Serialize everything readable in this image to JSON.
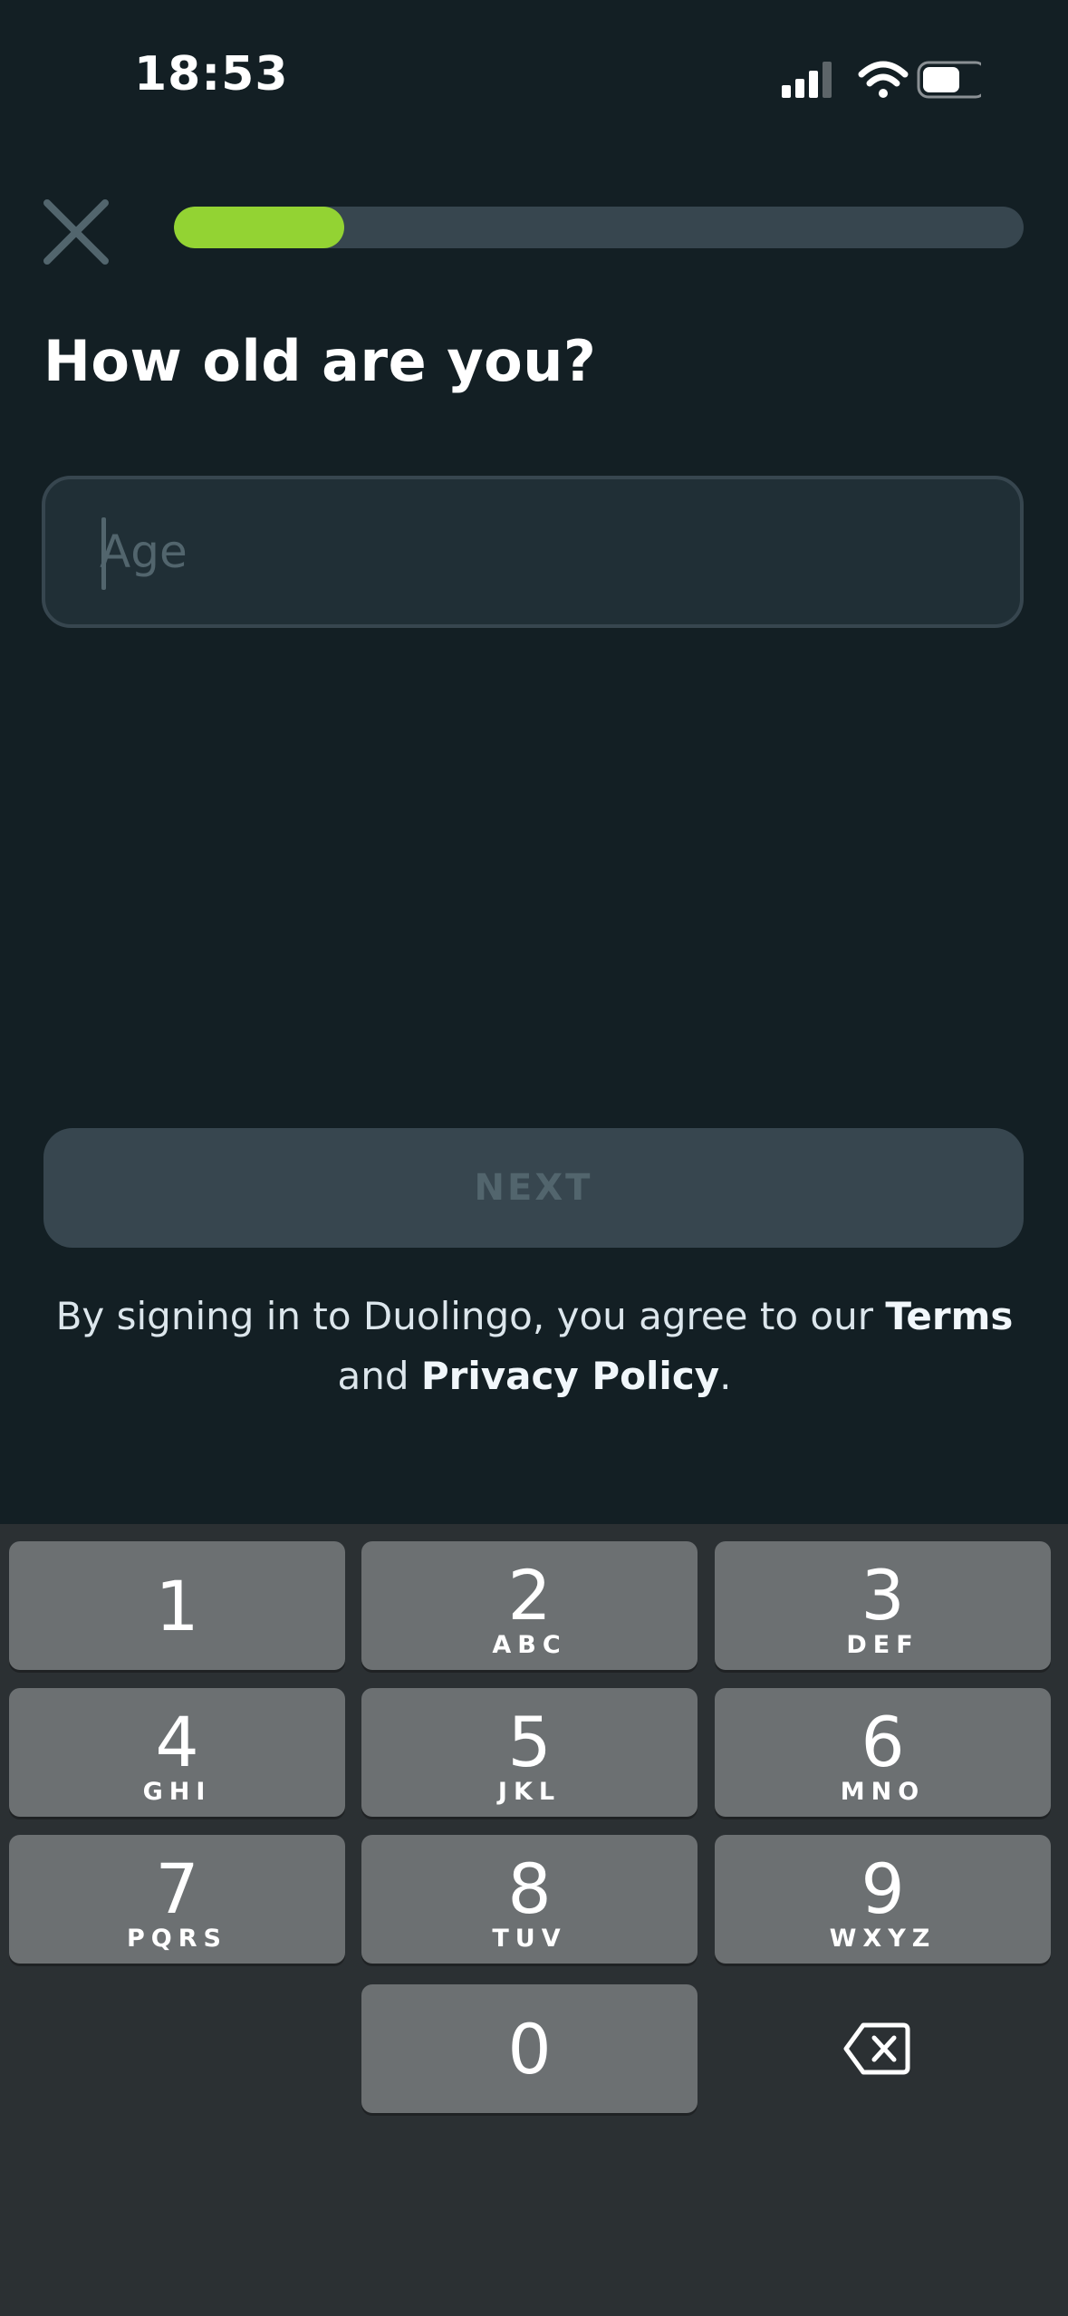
{
  "status_bar": {
    "time": "18:53",
    "icons": [
      "cellular-signal-icon",
      "wifi-icon",
      "battery-icon"
    ]
  },
  "header": {
    "close_icon": "close-icon",
    "progress": 0.2
  },
  "question": {
    "title": "How old are you?"
  },
  "age_input": {
    "placeholder": "Age",
    "value": ""
  },
  "next_button": {
    "label": "NEXT"
  },
  "legal": {
    "prefix": "By signing in to Duolingo, you agree to our ",
    "terms": "Terms",
    "middle": " and ",
    "privacy": "Privacy Policy",
    "suffix": "."
  },
  "keypad": {
    "keys": [
      {
        "digit": "1",
        "letters": ""
      },
      {
        "digit": "2",
        "letters": "ABC"
      },
      {
        "digit": "3",
        "letters": "DEF"
      },
      {
        "digit": "4",
        "letters": "GHI"
      },
      {
        "digit": "5",
        "letters": "JKL"
      },
      {
        "digit": "6",
        "letters": "MNO"
      },
      {
        "digit": "7",
        "letters": "PQRS"
      },
      {
        "digit": "8",
        "letters": "TUV"
      },
      {
        "digit": "9",
        "letters": "WXYZ"
      },
      {
        "digit": "0",
        "letters": ""
      }
    ],
    "delete_icon": "backspace-icon"
  },
  "colors": {
    "background": "#131f24",
    "progress_fill": "#93d333",
    "track": "#37464f",
    "keyboard": "#2b3033",
    "key": "#6c7072"
  }
}
